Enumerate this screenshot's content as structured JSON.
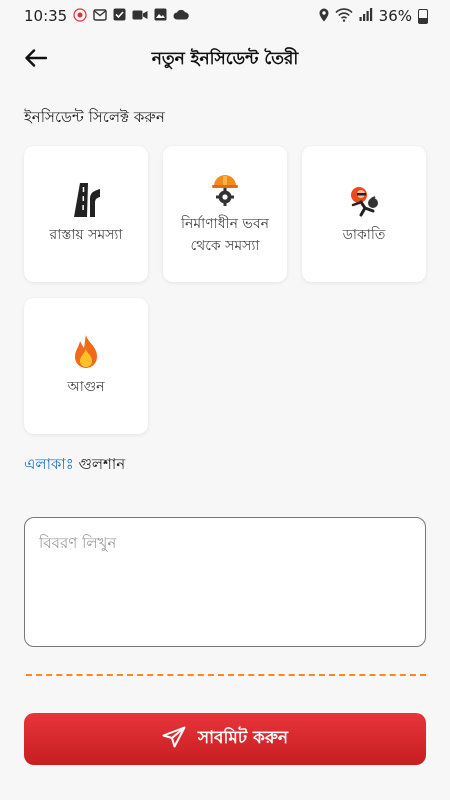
{
  "status": {
    "time": "10:35",
    "battery_text": "36%",
    "notification_icons": [
      "app-icon",
      "gmail-icon",
      "check-icon",
      "video-icon",
      "image-icon",
      "cloud-icon"
    ],
    "system_icons": [
      "location-icon",
      "wifi-icon",
      "signal-icon",
      "battery-icon"
    ]
  },
  "header": {
    "title": "নতুন ইনসিডেন্ট তৈরী",
    "back_icon": "arrow-left-icon"
  },
  "section_label": "ইনসিডেন্ট সিলেক্ট করুন",
  "incident_types": [
    {
      "label": "রাস্তায় সমস্যা",
      "icon": "road-icon"
    },
    {
      "label": "নির্মাণাধীন ভবন থেকে সমস্যা",
      "icon": "construction-helmet-icon"
    },
    {
      "label": "ডাকাতি",
      "icon": "robber-icon"
    },
    {
      "label": "আগুন",
      "icon": "fire-icon"
    }
  ],
  "area": {
    "label": "এলাকাঃ",
    "value": "গুলশান"
  },
  "description": {
    "placeholder": "বিবরণ লিখুন",
    "value": ""
  },
  "submit": {
    "label": "সাবমিট করুন",
    "icon": "send-icon"
  },
  "colors": {
    "accent_red": "#d62a2e",
    "link_blue": "#1f6fbf",
    "divider_orange": "#f08a2a",
    "background": "#f7f7f7"
  }
}
